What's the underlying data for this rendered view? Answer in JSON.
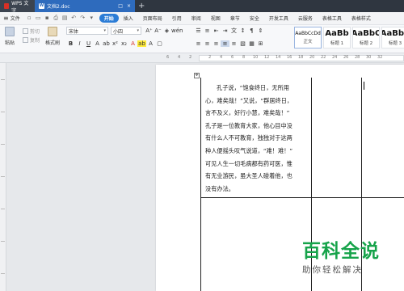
{
  "titlebar": {
    "app_tab": "WPS 文字",
    "doc_tab": "文档2.doc",
    "new_tab": "+"
  },
  "menubar": {
    "file": "文件",
    "items": [
      "开始",
      "插入",
      "页面布局",
      "引用",
      "审阅",
      "视图",
      "章节",
      "安全",
      "开发工具",
      "云服务",
      "表格工具",
      "表格样式"
    ],
    "active_index": 0
  },
  "ribbon": {
    "paste": "粘贴",
    "cut": "剪切",
    "copy": "复制",
    "format_painter": "格式刷",
    "font_name": "宋体",
    "font_size": "小四",
    "styles": [
      {
        "preview": "AaBbCcDd",
        "name": "正文"
      },
      {
        "preview": "AaBb",
        "name": "标题 1"
      },
      {
        "preview": "AaBbC",
        "name": "标题 2"
      },
      {
        "preview": "AaBbC",
        "name": "标题 3"
      }
    ]
  },
  "ruler": {
    "marks": [
      "6",
      "4",
      "2",
      "2",
      "4",
      "6",
      "8",
      "10",
      "12",
      "14",
      "16",
      "18",
      "20",
      "22",
      "24",
      "26",
      "28",
      "30",
      "32"
    ]
  },
  "document": {
    "cell_lines": [
      "孔子说，“饱食终日，无所用",
      "心，难矣哉！”又说，“群居终日，",
      "言不及义，好行小慧，难矣哉！”",
      "孔子是一位教育大家，他心目中没",
      "有什么人不可教育，独独对于这两",
      "种人便摇头叹气说道，“难！难！”",
      "可见人生一切毛病都有药可医，惟",
      "有无业游民，虽大圣人碰着他，也",
      "没有办法。"
    ]
  },
  "watermark": {
    "title": "百科全说",
    "subtitle": "助你轻松解决"
  },
  "colors": {
    "accent": "#2b7cd6",
    "titlebar": "#2f3640",
    "watermark_green": "#16a34a"
  }
}
